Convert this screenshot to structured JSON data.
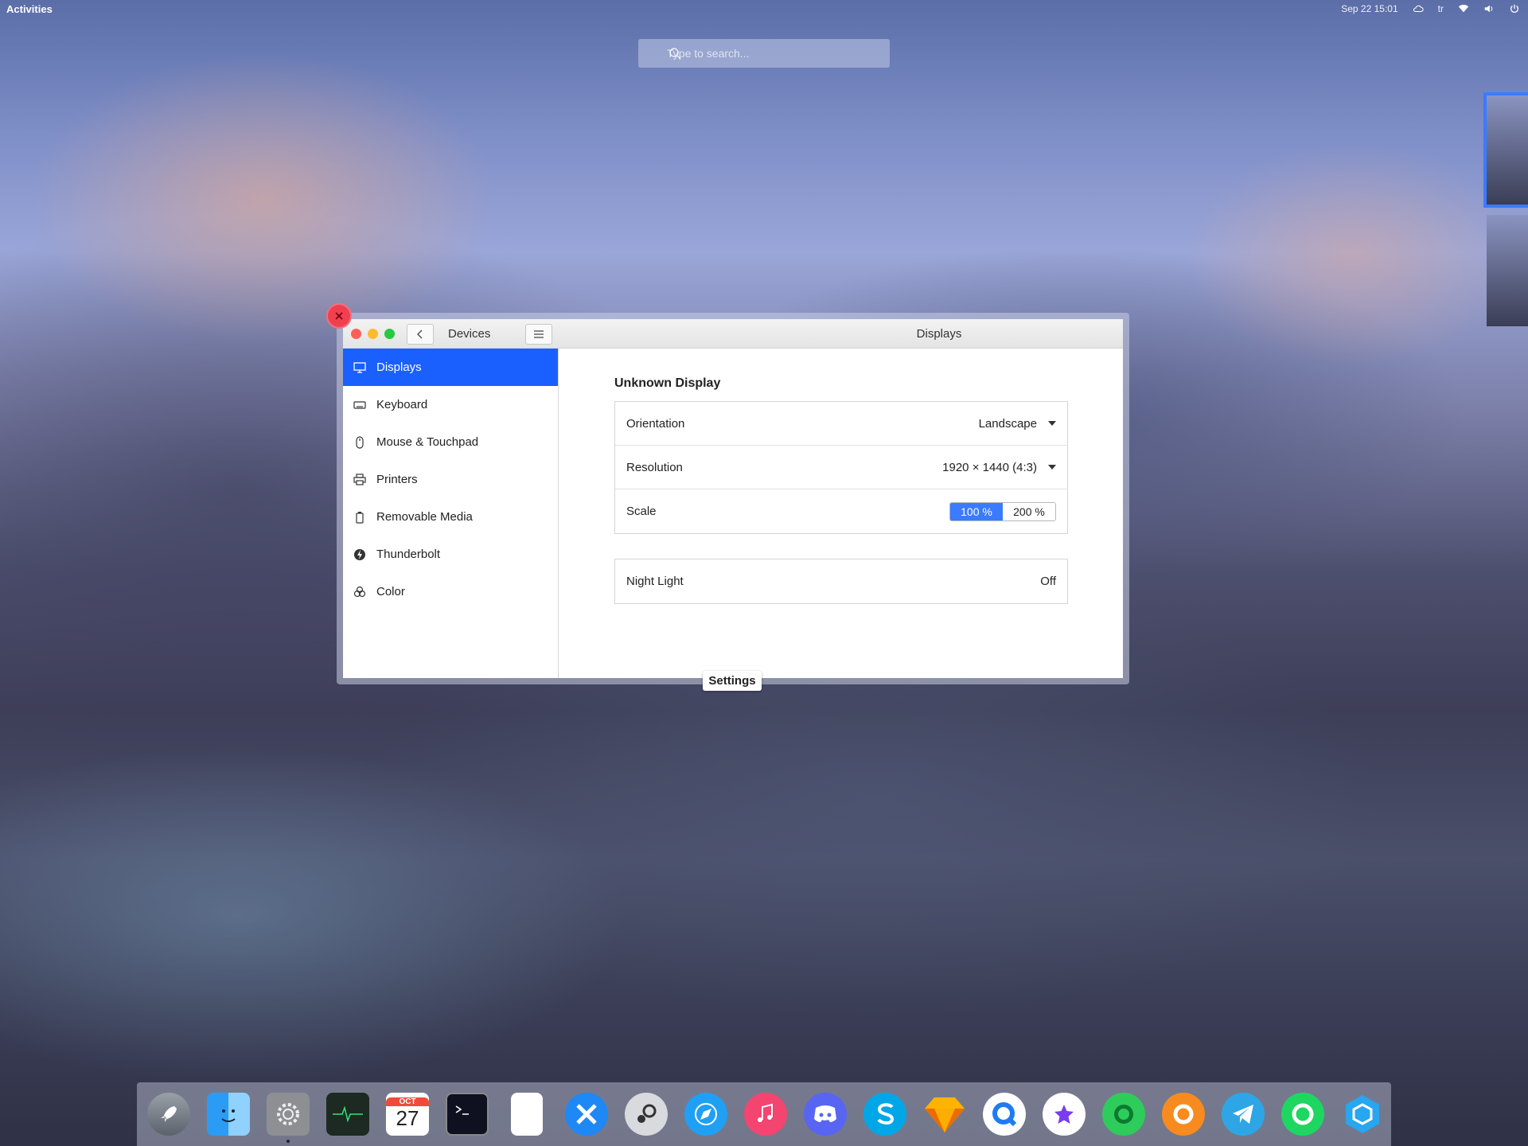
{
  "topbar": {
    "activities": "Activities",
    "datetime": "Sep 22  15:01",
    "keyboard_layout": "tr"
  },
  "search": {
    "placeholder": "Type to search..."
  },
  "window": {
    "header_left_title": "Devices",
    "header_panel_title": "Displays",
    "overview_label": "Settings"
  },
  "sidebar": {
    "items": [
      {
        "label": "Displays",
        "icon": "display-icon",
        "active": true
      },
      {
        "label": "Keyboard",
        "icon": "keyboard-icon"
      },
      {
        "label": "Mouse & Touchpad",
        "icon": "mouse-icon"
      },
      {
        "label": "Printers",
        "icon": "printer-icon"
      },
      {
        "label": "Removable Media",
        "icon": "usb-icon"
      },
      {
        "label": "Thunderbolt",
        "icon": "thunderbolt-icon"
      },
      {
        "label": "Color",
        "icon": "color-icon"
      }
    ]
  },
  "display": {
    "name": "Unknown Display",
    "orientation": {
      "label": "Orientation",
      "value": "Landscape"
    },
    "resolution": {
      "label": "Resolution",
      "value": "1920 × 1440 (4:3)"
    },
    "scale": {
      "label": "Scale",
      "options": [
        "100 %",
        "200 %"
      ],
      "selected": "100 %"
    },
    "night_light": {
      "label": "Night Light",
      "value": "Off"
    }
  },
  "dock": {
    "apps": [
      "launchpad-icon",
      "finder-icon",
      "system-settings-icon",
      "system-monitor-icon",
      "calendar-icon",
      "terminal-icon",
      "text-editor-icon",
      "xcode-icon",
      "steam-icon",
      "safari-icon",
      "music-icon",
      "discord-icon",
      "skype-icon",
      "sketch-icon",
      "quicktime-icon",
      "imovie-icon",
      "messages-icon",
      "origin-icon",
      "telegram-icon",
      "spotify-icon",
      "hexagon-app-icon"
    ],
    "calendar": {
      "month": "OCT",
      "day": "27"
    }
  }
}
